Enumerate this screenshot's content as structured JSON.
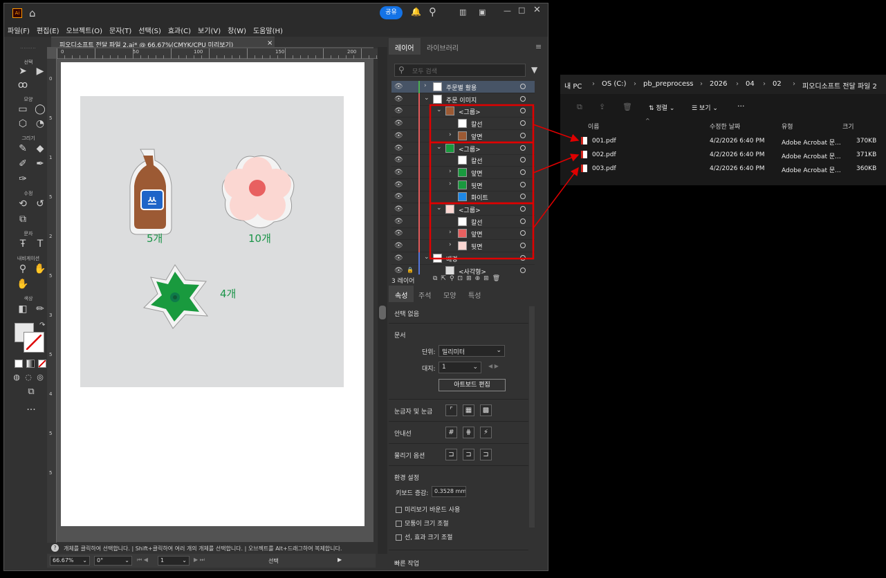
{
  "app": {
    "logo": "Ai",
    "share_label": "공유"
  },
  "menu": [
    "파일(F)",
    "편집(E)",
    "오브젝트(O)",
    "문자(T)",
    "선택(S)",
    "효과(C)",
    "보기(V)",
    "창(W)",
    "도움말(H)"
  ],
  "toolbar": {
    "select": "선택",
    "shape": "모양",
    "draw": "그리기",
    "modify": "수정",
    "type": "문자",
    "nav": "내비게이션",
    "color": "색상"
  },
  "document": {
    "tab_title": "피오디소프트 전달 파일 2.ai* @ 66.67%(CMYK/CPU 미리보기)",
    "close": "×"
  },
  "ruler": {
    "h": [
      "0",
      "50",
      "100",
      "150",
      "200"
    ],
    "v": [
      "0",
      "5",
      "1",
      "5",
      "2",
      "5",
      "3",
      "5",
      "4",
      "5",
      "5"
    ]
  },
  "art": {
    "count1": "5개",
    "count2": "10개",
    "count3": "4개",
    "bottle_text": "쓰"
  },
  "status": {
    "hint": "개체를 클릭하여 선택합니다. | Shift+클릭하여 여러 개의 개체를 선택합니다. | 오브젝트를 Alt+드래그하여 복제합니다.",
    "zoom": "66.67%",
    "rotate": "0°",
    "artboard": "1",
    "mode": "선택"
  },
  "layers": {
    "tab1": "레이어",
    "tab2": "라이브러리",
    "search_placeholder": "모두 검색",
    "count": "3 레이어",
    "rows": [
      {
        "name": "주문별 활용",
        "color": "#4caf50"
      },
      {
        "name": "주문 이미지",
        "color": "#e05a5a"
      },
      {
        "name": "<그룹>",
        "color": "#e05a5a"
      },
      {
        "name": "칼선",
        "color": "#e05a5a"
      },
      {
        "name": "앞면",
        "color": "#e05a5a"
      },
      {
        "name": "<그룹>",
        "color": "#e05a5a"
      },
      {
        "name": "칼선",
        "color": "#e05a5a"
      },
      {
        "name": "앞면",
        "color": "#e05a5a"
      },
      {
        "name": "뒷면",
        "color": "#e05a5a"
      },
      {
        "name": "화이트",
        "color": "#e05a5a"
      },
      {
        "name": "<그룹>",
        "color": "#e05a5a"
      },
      {
        "name": "칼선",
        "color": "#e05a5a"
      },
      {
        "name": "앞면",
        "color": "#e05a5a"
      },
      {
        "name": "뒷면",
        "color": "#e05a5a"
      },
      {
        "name": "배경",
        "color": "#5577dd"
      },
      {
        "name": "<사각형>",
        "color": "#5577dd"
      }
    ]
  },
  "props": {
    "tabs": [
      "속성",
      "주석",
      "모양",
      "특성"
    ],
    "no_selection": "선택 없음",
    "document": "문서",
    "unit_label": "단위:",
    "unit_value": "밀리미터",
    "artboard_label": "대지:",
    "artboard_value": "1",
    "edit_artboards": "아트보드 편집",
    "rulers_grids": "눈금자 및 눈금",
    "guides": "안내선",
    "snap": "물리기 옵션",
    "prefs": "환경 설정",
    "keyboard_inc_label": "키보드 증감:",
    "keyboard_inc": "0.3528 mm",
    "cb1": "미리보기 바운드 사용",
    "cb2": "모퉁이 크기 조절",
    "cb3": "선, 효과 크기 조절",
    "quick": "빠른 작업"
  },
  "explorer": {
    "path": [
      "내 PC",
      "OS (C:)",
      "pb_preprocess",
      "2026",
      "04",
      "02",
      "피오디소프트 전달 파일 2"
    ],
    "sort": "정렬",
    "view": "보기",
    "more": "···",
    "headers": [
      "이름",
      "수정한 날짜",
      "유형",
      "크기"
    ],
    "files": [
      {
        "name": "001.pdf",
        "date": "4/2/2026 6:40 PM",
        "type": "Adobe Acrobat 문...",
        "size": "370KB"
      },
      {
        "name": "002.pdf",
        "date": "4/2/2026 6:40 PM",
        "type": "Adobe Acrobat 문...",
        "size": "371KB"
      },
      {
        "name": "003.pdf",
        "date": "4/2/2026 6:40 PM",
        "type": "Adobe Acrobat 문...",
        "size": "360KB"
      }
    ]
  },
  "colors": {
    "accent": "#1473e6",
    "highlight": "#e00000",
    "count_green": "#1a9448"
  }
}
